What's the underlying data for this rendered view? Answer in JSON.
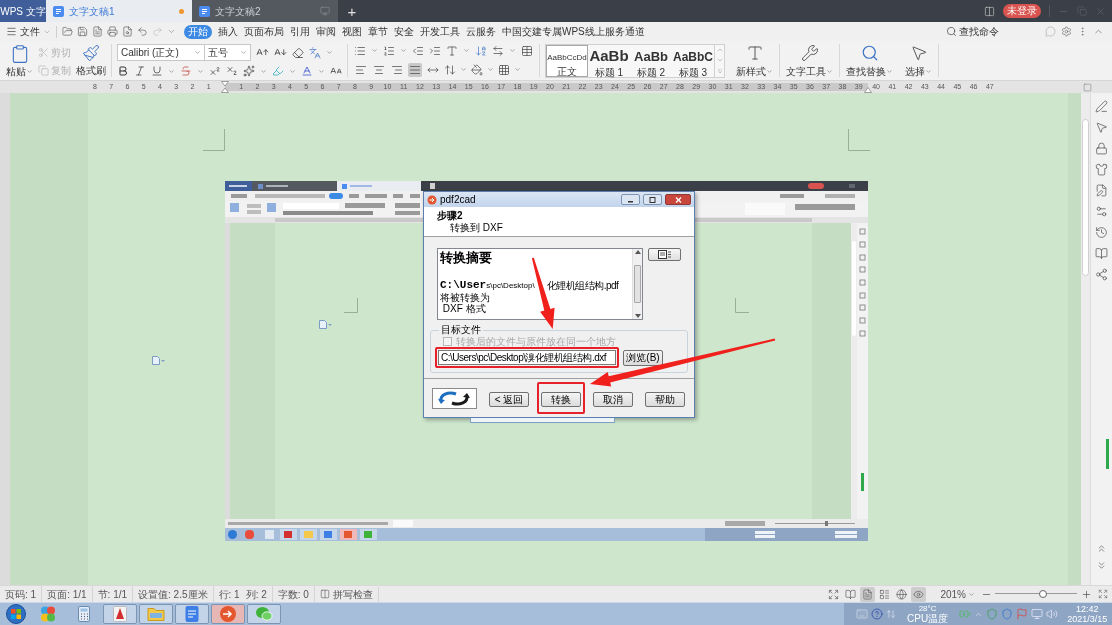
{
  "title_bar": {
    "app_tab": "WPS 文字",
    "doc_tabs": [
      {
        "label": "文字文稿1",
        "selected": true,
        "modified": true
      },
      {
        "label": "文字文稿2",
        "selected": false,
        "modified": false
      }
    ],
    "new_tab": "+",
    "account": "未登录"
  },
  "menu_bar": {
    "file_menu": "文件",
    "tabs": [
      {
        "label": "开始",
        "selected": true
      },
      {
        "label": "插入",
        "selected": false
      },
      {
        "label": "页面布局",
        "selected": false
      },
      {
        "label": "引用",
        "selected": false
      },
      {
        "label": "审阅",
        "selected": false
      },
      {
        "label": "视图",
        "selected": false
      },
      {
        "label": "章节",
        "selected": false
      },
      {
        "label": "安全",
        "selected": false
      },
      {
        "label": "开发工具",
        "selected": false
      },
      {
        "label": "云服务",
        "selected": false
      },
      {
        "label": "中国交建专属WPS线上服务通道",
        "selected": false
      }
    ],
    "command_search": "查找命令"
  },
  "ribbon": {
    "paste": "粘贴",
    "cut": {
      "label": "剪切",
      "disabled": true
    },
    "copy": {
      "label": "复制",
      "disabled": true
    },
    "format_painter": "格式刷",
    "font_family": "Calibri (正文)",
    "font_size": "五号",
    "alignment": [
      {
        "kind": "left",
        "selected": false
      },
      {
        "kind": "center",
        "selected": false
      },
      {
        "kind": "right",
        "selected": false
      },
      {
        "kind": "justify",
        "selected": true
      },
      {
        "kind": "distributed",
        "selected": false
      }
    ],
    "styles": [
      {
        "preview": "AaBbCcDd",
        "label": "正文",
        "selected": true
      },
      {
        "preview": "AaBb",
        "label": "标题 1",
        "selected": false
      },
      {
        "preview": "AaBb",
        "label": "标题 2",
        "selected": false
      },
      {
        "preview": "AaBbC",
        "label": "标题 3",
        "selected": false
      }
    ],
    "tools": [
      {
        "kind": "new_style",
        "label": "新样式"
      },
      {
        "kind": "text_tools",
        "label": "文字工具"
      },
      {
        "kind": "find_replace",
        "label": "查找替换"
      },
      {
        "kind": "select",
        "label": "选择"
      }
    ]
  },
  "ruler": {
    "left_ticks": [
      "8",
      "7",
      "6",
      "5",
      "4",
      "3",
      "2",
      "1"
    ],
    "right_ticks": [
      "1",
      "2",
      "3",
      "4",
      "5",
      "6",
      "7",
      "8",
      "9",
      "10",
      "11",
      "12",
      "13",
      "14",
      "15",
      "16",
      "17",
      "18",
      "19",
      "20",
      "21",
      "22",
      "23",
      "24",
      "25",
      "26",
      "27",
      "28",
      "29",
      "30",
      "31",
      "32",
      "33",
      "34",
      "35",
      "36",
      "37",
      "38",
      "39",
      "40",
      "41",
      "42",
      "43",
      "44",
      "45",
      "46",
      "47"
    ]
  },
  "document": {
    "embedded_screenshot": {
      "dialog": {
        "title": "pdf2cad",
        "step": "步骤2",
        "step_desc": "转换到 DXF",
        "summary_title": "转换摘要",
        "source_path_parts": [
          "**C:\\User**s\\pc\\Desktop\\",
          "化锂机组结构.pdf"
        ],
        "summary_lines": [
          "将被转换为",
          " DXF 格式"
        ],
        "group_title": "目标文件",
        "same_folder": {
          "label": "转换后的文件与原件放在同一个地方",
          "checked": false,
          "disabled": true
        },
        "target_field": {
          "value": "C:\\Users\\pc\\Desktop\\溴化锂机组结构.dxf",
          "highlighted": true
        },
        "browse": "浏览(B)",
        "buttons": [
          {
            "label": "< 返回",
            "highlighted": false
          },
          {
            "label": "转换",
            "highlighted": true
          },
          {
            "label": "取消",
            "highlighted": false
          },
          {
            "label": "帮助",
            "highlighted": false
          }
        ]
      }
    }
  },
  "status_bar": {
    "cells": [
      [
        "页码: 1"
      ],
      [
        "页面: 1/1"
      ],
      [
        "节: 1/1"
      ],
      [
        "设置值: 2.5厘米"
      ],
      [
        "行: 1",
        "列: 2"
      ],
      [
        "字数: 0"
      ]
    ],
    "spell_check": "拼写检查",
    "view_modes": [
      {
        "kind": "fullscreen",
        "selected": false
      },
      {
        "kind": "reading",
        "selected": false
      },
      {
        "kind": "page",
        "selected": true
      },
      {
        "kind": "outline",
        "selected": false
      },
      {
        "kind": "web",
        "selected": false
      },
      {
        "kind": "eye",
        "selected": true
      }
    ],
    "zoom": "201%",
    "zoom_slider": {
      "level": 0.59
    }
  },
  "taskbar": {
    "apps": [
      {
        "kind": "colorful",
        "running": false,
        "selected": false
      },
      {
        "kind": "calculator",
        "running": false,
        "selected": false
      },
      {
        "kind": "acrobat",
        "running": true,
        "selected": false
      },
      {
        "kind": "folder",
        "running": true,
        "selected": false
      },
      {
        "kind": "wps",
        "running": true,
        "selected": false
      },
      {
        "kind": "pdf2cad",
        "running": true,
        "selected": true
      },
      {
        "kind": "wechat",
        "running": true,
        "selected": false
      }
    ],
    "temperature": "28°C",
    "sensor": "CPU温度",
    "time": "12:42",
    "date": "2021/3/15"
  }
}
